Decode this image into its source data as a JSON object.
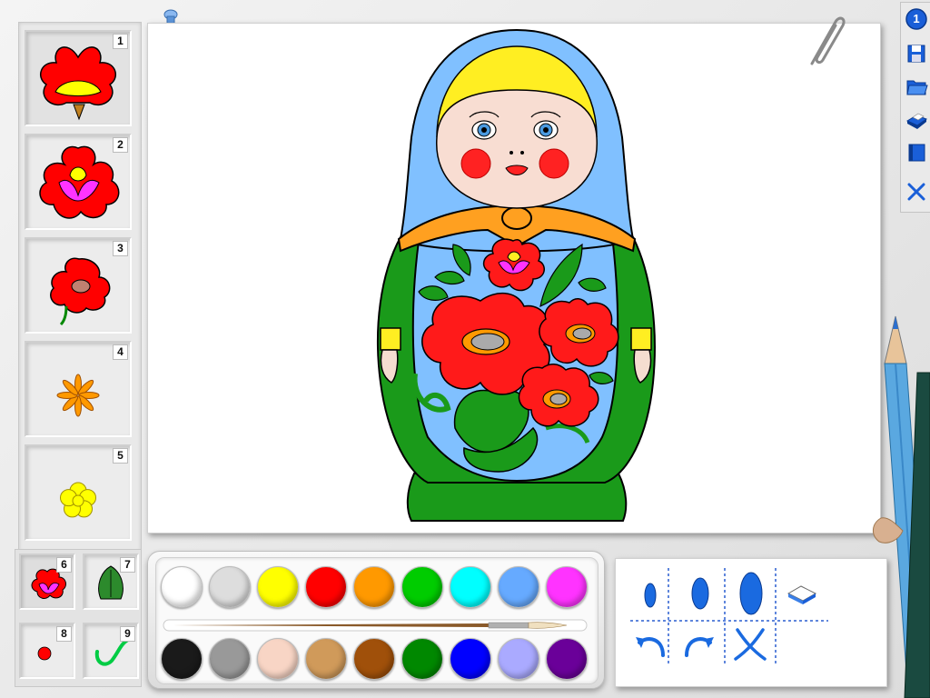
{
  "stamps": [
    {
      "number": "1",
      "icon": "red-flower-with-yellow-center-icon"
    },
    {
      "number": "2",
      "icon": "red-flower-with-magenta-petals-icon"
    },
    {
      "number": "3",
      "icon": "red-poppy-with-stem-icon"
    },
    {
      "number": "4",
      "icon": "orange-star-flower-icon"
    },
    {
      "number": "5",
      "icon": "yellow-flower-icon"
    }
  ],
  "small_stamps": [
    {
      "number": "6",
      "icon": "small-red-flower-icon"
    },
    {
      "number": "7",
      "icon": "green-leaf-icon"
    },
    {
      "number": "8",
      "icon": "red-dot-icon"
    },
    {
      "number": "9",
      "icon": "green-swirl-icon"
    }
  ],
  "toolbar": {
    "badge": "1",
    "items": [
      "save-icon",
      "open-folder-icon",
      "print-icon",
      "book-icon",
      "close-icon"
    ]
  },
  "palette": {
    "top_row": [
      "#ffffff",
      "#dddddd",
      "#ffff00",
      "#ff0000",
      "#ff9900",
      "#00cc00",
      "#00ffff",
      "#66aaff",
      "#ff33ff"
    ],
    "bottom_row": [
      "#1a1a1a",
      "#999999",
      "#f8d5c5",
      "#d09a5a",
      "#a0500a",
      "#008800",
      "#0000ff",
      "#aaaaff",
      "#6a0099"
    ]
  },
  "brush_tools": [
    "small-brush-icon",
    "medium-brush-icon",
    "large-brush-icon",
    "eraser-icon",
    "undo-icon",
    "redo-icon",
    "clear-icon"
  ],
  "drawing": "matryoshka-doll"
}
